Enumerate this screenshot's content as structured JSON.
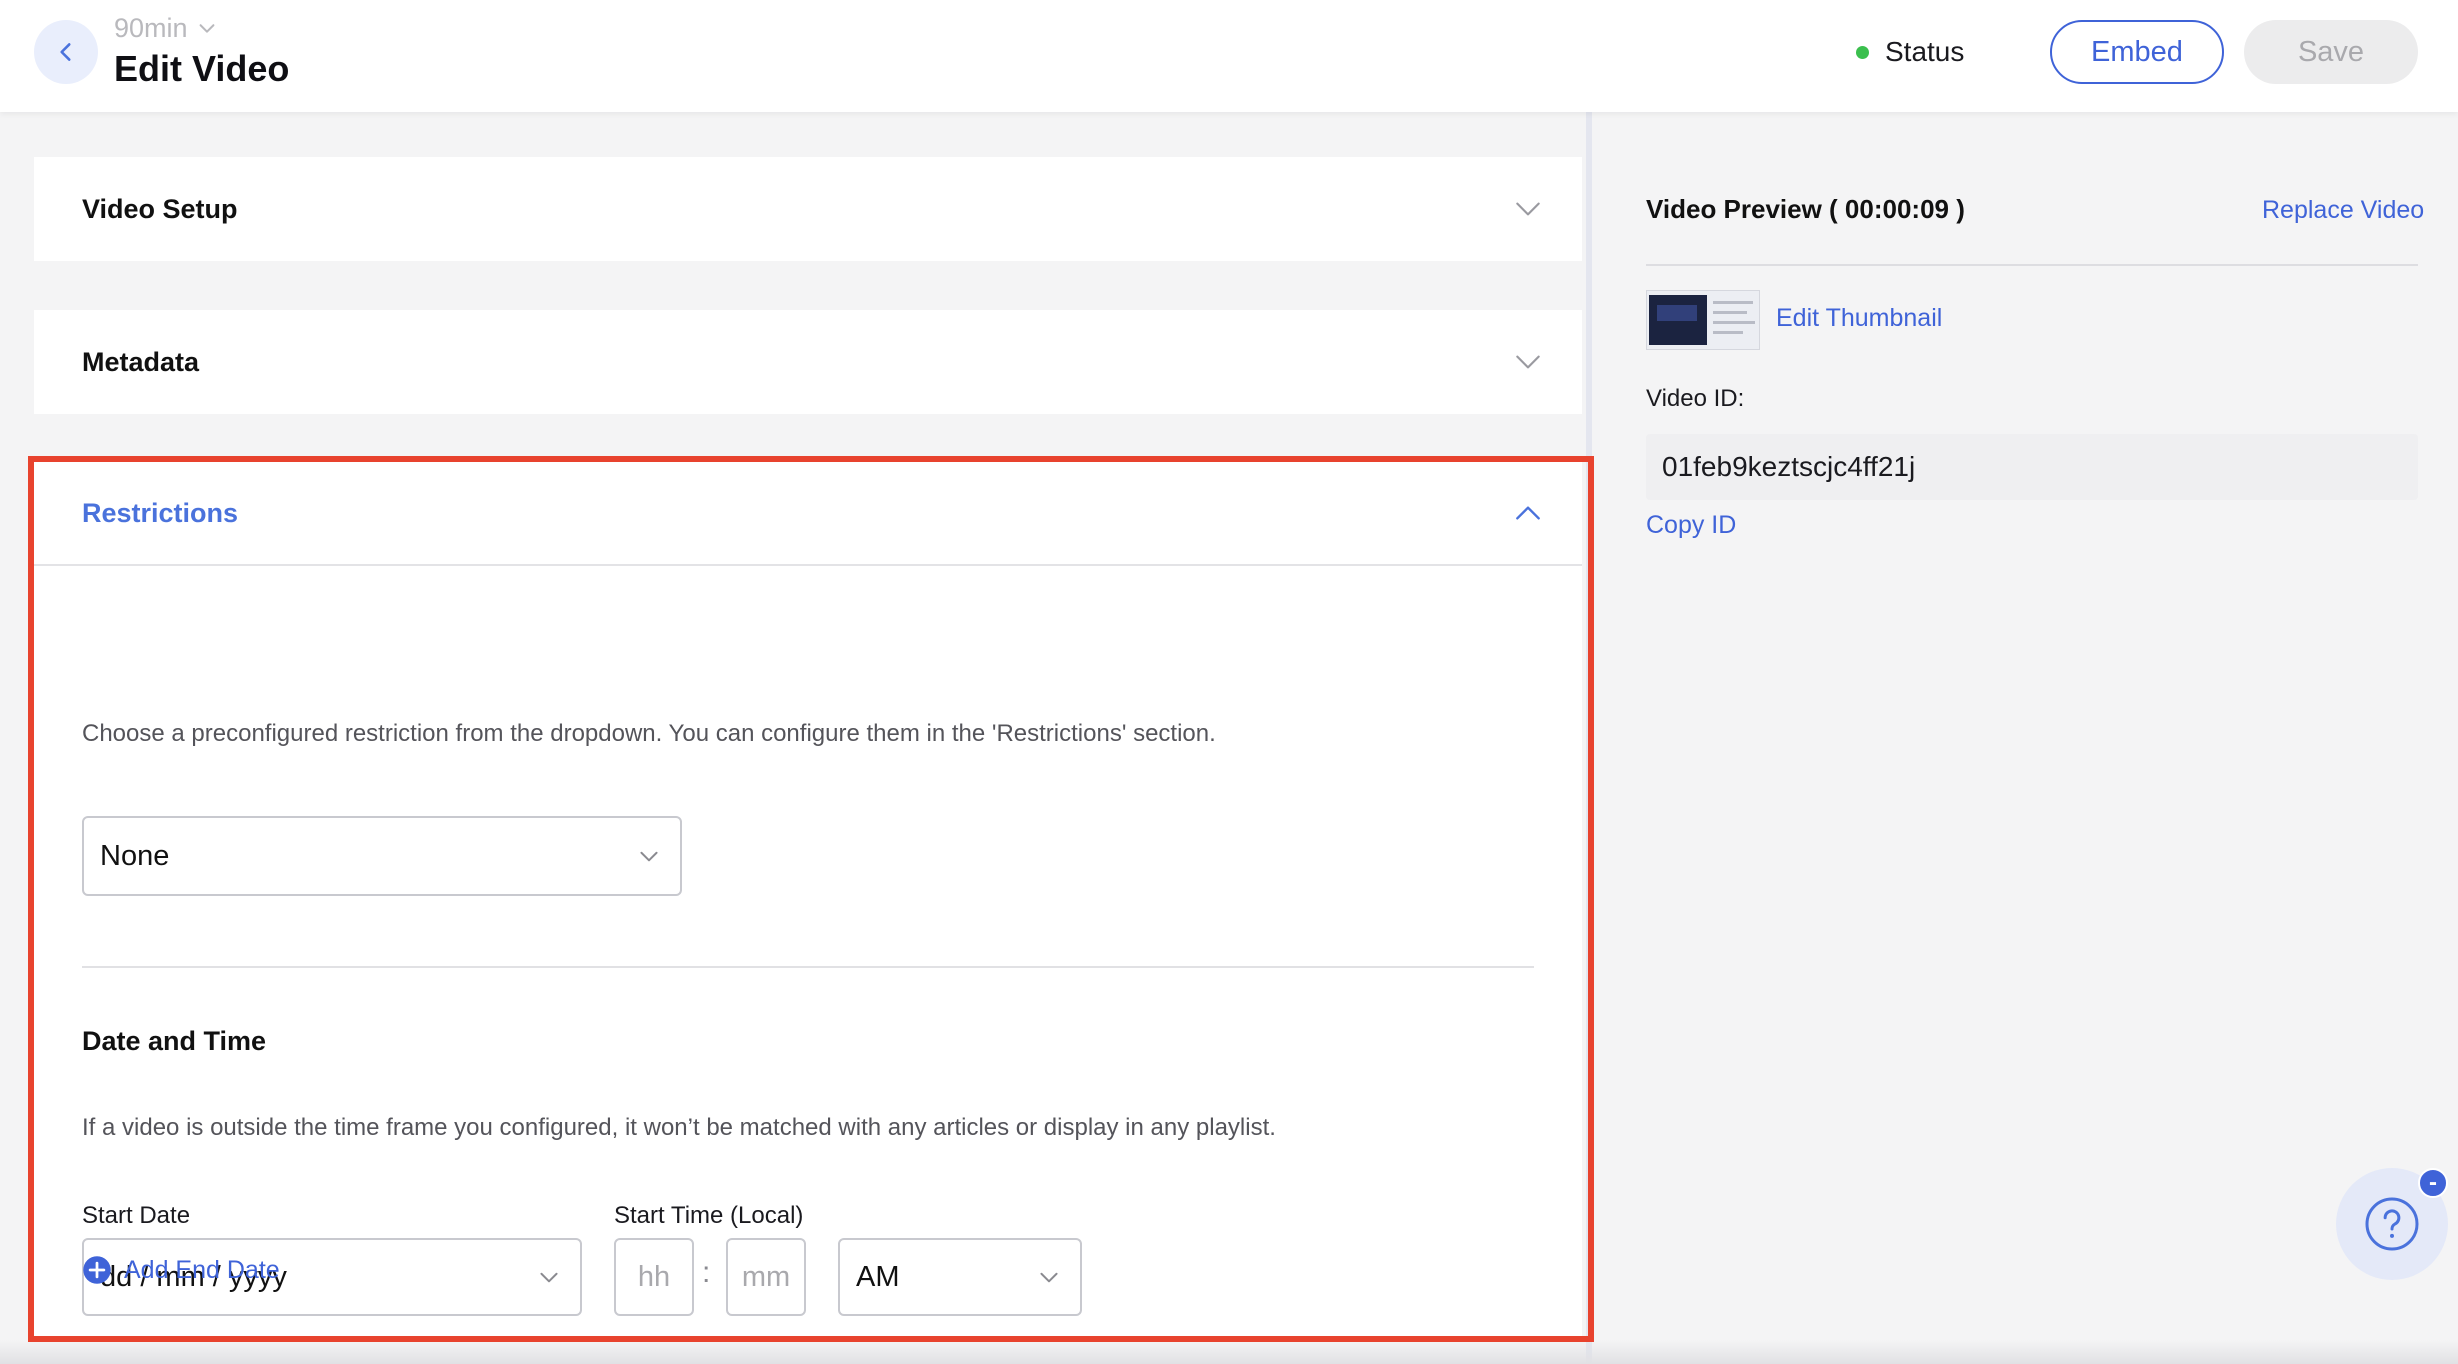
{
  "header": {
    "account": "90min",
    "title": "Edit Video",
    "status_label": "Status",
    "status_color": "#3bbf4e",
    "embed_label": "Embed",
    "save_label": "Save"
  },
  "sections": {
    "video_setup": {
      "title": "Video Setup"
    },
    "metadata": {
      "title": "Metadata"
    },
    "restrictions": {
      "title": "Restrictions",
      "description": "Choose a preconfigured restriction from the dropdown. You can configure them in the 'Restrictions' section.",
      "restriction_select_value": "None",
      "date_time": {
        "title": "Date and Time",
        "description": "If a video is outside the time frame you configured, it won’t be matched with any articles or display in any playlist.",
        "start_date_label": "Start Date",
        "start_date_placeholder": "dd / mm / yyyy",
        "start_time_label": "Start Time (Local)",
        "hour_placeholder": "hh",
        "minute_placeholder": "mm",
        "time_separator": ":",
        "ampm_value": "AM",
        "add_end_date_label": "Add End Date"
      }
    }
  },
  "preview": {
    "title": "Video Preview ( 00:00:09 )",
    "replace_label": "Replace Video",
    "edit_thumbnail_label": "Edit Thumbnail",
    "video_id_label": "Video ID:",
    "video_id": "01feb9keztscjc4ff21j",
    "copy_id_label": "Copy ID"
  },
  "help": {
    "icon": "question-mark-icon",
    "badge": "-"
  },
  "colors": {
    "accent": "#3f63d8",
    "highlight_outline": "#e8432e"
  }
}
